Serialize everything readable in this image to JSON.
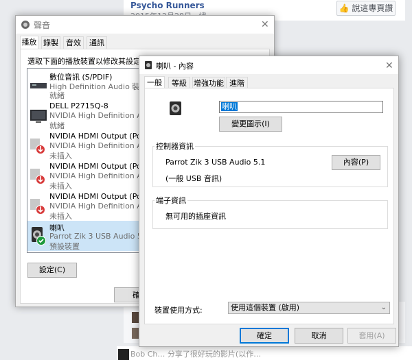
{
  "background": {
    "page_title": "Psycho Runners",
    "page_date": "2015年12月28日 · 繡",
    "like_button": "說這專頁讚",
    "bottom_text": "Bob Ch… 分享了很好玩的影片(以作…"
  },
  "sound_window": {
    "title": "聲音",
    "tabs": [
      "播放",
      "錄製",
      "音效",
      "通訊"
    ],
    "instruction": "選取下面的播放裝置以修改其設定:",
    "devices": [
      {
        "name": "數位音訊 (S/PDIF)",
        "driver": "High Definition Audio 裝置",
        "status": "就緒",
        "icon": "spdif-device-icon"
      },
      {
        "name": "DELL P2715Q-8",
        "driver": "NVIDIA High Definition Aud",
        "status": "就緒",
        "icon": "monitor-icon"
      },
      {
        "name": "NVIDIA HDMI Output (Port",
        "driver": "NVIDIA High Definition Aud",
        "status": "未插入",
        "icon": "hdmi-unplugged-icon"
      },
      {
        "name": "NVIDIA HDMI Output (Port",
        "driver": "NVIDIA High Definition Aud",
        "status": "未插入",
        "icon": "hdmi-unplugged-icon"
      },
      {
        "name": "NVIDIA HDMI Output (Port",
        "driver": "NVIDIA High Definition Aud",
        "status": "未插入",
        "icon": "hdmi-unplugged-icon"
      },
      {
        "name": "喇叭",
        "driver": "Parrot Zik 3 USB Audio 5.1",
        "status": "預設裝置",
        "icon": "speaker-default-icon"
      }
    ],
    "configure_button": "設定(C)",
    "ok_button_partial": "確"
  },
  "properties_window": {
    "title": "喇叭 - 內容",
    "tabs": [
      "一般",
      "等級",
      "增強功能",
      "進階"
    ],
    "name_value": "喇叭",
    "change_icon_button": "變更圖示(I)",
    "controller_group_title": "控制器資訊",
    "controller_name": "Parrot Zik 3 USB Audio 5.1",
    "controller_type": "(一般 USB 音訊)",
    "properties_button": "內容(P)",
    "jack_group_title": "端子資訊",
    "jack_info": "無可用的插座資訊",
    "usage_label": "裝置使用方式:",
    "usage_value": "使用這個裝置 (啟用)",
    "ok_button": "確定",
    "cancel_button": "取消",
    "apply_button": "套用(A)"
  },
  "colors": {
    "accent": "#0078d7",
    "selection": "#cce4f7",
    "link": "#365899"
  }
}
